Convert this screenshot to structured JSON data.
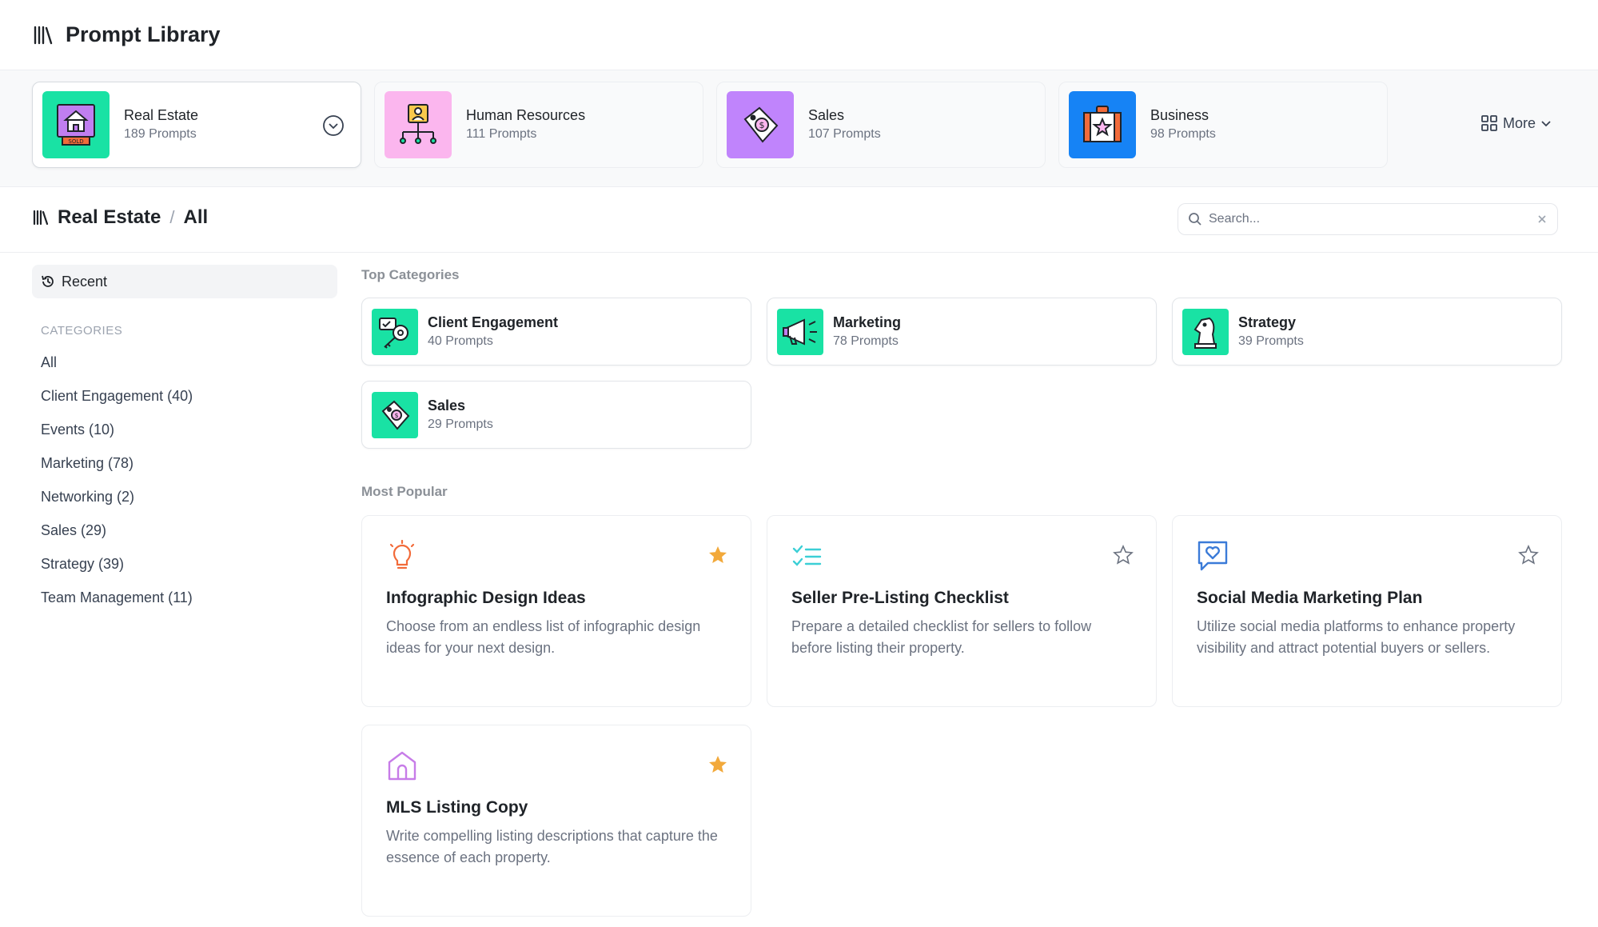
{
  "header": {
    "title": "Prompt Library",
    "logo_icon": "library-icon"
  },
  "industries": [
    {
      "name": "Real Estate",
      "count": "189 Prompts",
      "thumb_color": "#19e2a4",
      "icon": "sold-house-sign-icon",
      "active": true
    },
    {
      "name": "Human Resources",
      "count": "111 Prompts",
      "thumb_color": "#fbb6ee",
      "icon": "org-chart-icon",
      "active": false
    },
    {
      "name": "Sales",
      "count": "107 Prompts",
      "thumb_color": "#c084fc",
      "icon": "price-tag-icon",
      "active": false
    },
    {
      "name": "Business",
      "count": "98 Prompts",
      "thumb_color": "#1683f5",
      "icon": "briefcase-star-icon",
      "active": false
    }
  ],
  "more_label": "More",
  "breadcrumb": {
    "root": "Real Estate",
    "separator": "/",
    "current": "All"
  },
  "search": {
    "placeholder": "Search..."
  },
  "sidebar": {
    "recent_label": "Recent",
    "categories_heading": "CATEGORIES",
    "categories": [
      "All",
      "Client Engagement (40)",
      "Events (10)",
      "Marketing (78)",
      "Networking (2)",
      "Sales (29)",
      "Strategy (39)",
      "Team Management (11)"
    ]
  },
  "top_categories": {
    "label": "Top Categories",
    "items": [
      {
        "name": "Client Engagement",
        "count": "40 Prompts",
        "icon": "key-chat-icon"
      },
      {
        "name": "Marketing",
        "count": "78 Prompts",
        "icon": "megaphone-icon"
      },
      {
        "name": "Strategy",
        "count": "39 Prompts",
        "icon": "chess-knight-icon"
      },
      {
        "name": "Sales",
        "count": "29 Prompts",
        "icon": "price-tag-icon"
      }
    ]
  },
  "most_popular": {
    "label": "Most Popular",
    "items": [
      {
        "title": "Infographic Design Ideas",
        "description": "Choose from an endless list of infographic design ideas for your next design.",
        "icon": "lightbulb-icon",
        "icon_color": "#f26b3a",
        "starred": true
      },
      {
        "title": "Seller Pre-Listing Checklist",
        "description": "Prepare a detailed checklist for sellers to follow before listing their property.",
        "icon": "checklist-icon",
        "icon_color": "#3ccfd6",
        "starred": false
      },
      {
        "title": "Social Media Marketing Plan",
        "description": "Utilize social media platforms to enhance property visibility and attract potential buyers or sellers.",
        "icon": "heart-chat-icon",
        "icon_color": "#3b7bd8",
        "starred": false
      },
      {
        "title": "MLS Listing Copy",
        "description": "Write compelling listing descriptions that capture the essence of each property.",
        "icon": "house-icon",
        "icon_color": "#c77ce8",
        "starred": true
      }
    ]
  },
  "colors": {
    "star_filled": "#f2a93b",
    "star_empty": "#6b7280",
    "accent_green": "#19e2a4"
  }
}
